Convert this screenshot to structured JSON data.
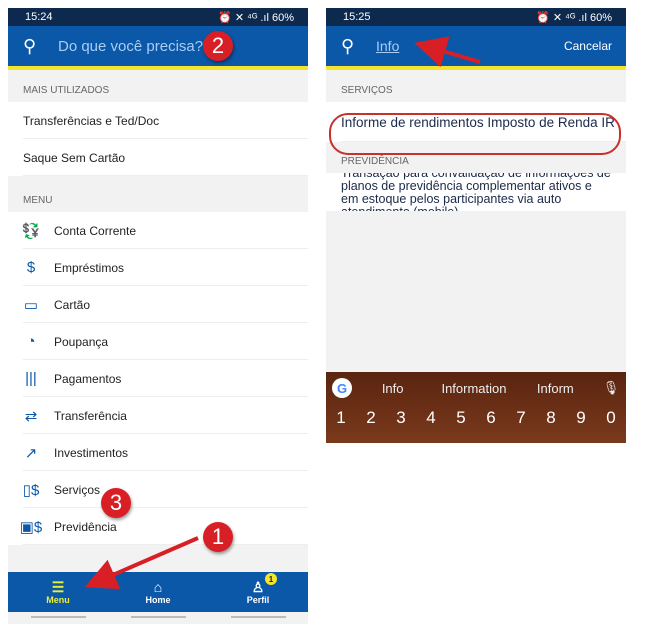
{
  "left": {
    "status": {
      "time": "15:24",
      "icons": "⏰ ✕ ⁴ᴳ .ıl",
      "battery": "60%"
    },
    "header": {
      "placeholder": "Do que você precisa?"
    },
    "section_top": "MAIS UTILIZADOS",
    "top_items": [
      "Transferências e Ted/Doc",
      "Saque Sem Cartão"
    ],
    "section_menu": "MENU",
    "menu": [
      {
        "label": "Conta Corrente",
        "icon": "money-icon"
      },
      {
        "label": "Empréstimos",
        "icon": "loan-icon"
      },
      {
        "label": "Cartão",
        "icon": "card-icon"
      },
      {
        "label": "Poupança",
        "icon": "piggy-bank-icon"
      },
      {
        "label": "Pagamentos",
        "icon": "barcode-icon"
      },
      {
        "label": "Transferência",
        "icon": "transfer-icon"
      },
      {
        "label": "Investimentos",
        "icon": "chart-icon"
      },
      {
        "label": "Serviços",
        "icon": "services-icon"
      },
      {
        "label": "Previdência",
        "icon": "calendar-money-icon"
      }
    ],
    "nav": {
      "menu": "Menu",
      "home": "Home",
      "profile": "Perfil",
      "badge": "1"
    }
  },
  "right": {
    "status": {
      "time": "15:25",
      "icons": "⏰ ✕ ⁴ᴳ .ıl",
      "battery": "60%"
    },
    "header": {
      "query": "Info",
      "cancel": "Cancelar"
    },
    "section_services": "SERVIÇOS",
    "result": "Informe de rendimentos Imposto de Renda IR",
    "section_prev": "PREVIDÊNCIA",
    "prev_text": "Transação para convalidação de informações de planos de previdência complementar ativos e em estoque pelos participantes via auto atendimento (mobile)",
    "keyboard": {
      "suggestions": [
        "Info",
        "Information",
        "Inform"
      ],
      "numbers": [
        "1",
        "2",
        "3",
        "4",
        "5",
        "6",
        "7",
        "8",
        "9",
        "0"
      ]
    }
  },
  "markers": [
    "1",
    "2",
    "3"
  ],
  "colors": {
    "header": "#0b57a8",
    "accent": "#f5e42b",
    "marker": "#d91f26"
  }
}
